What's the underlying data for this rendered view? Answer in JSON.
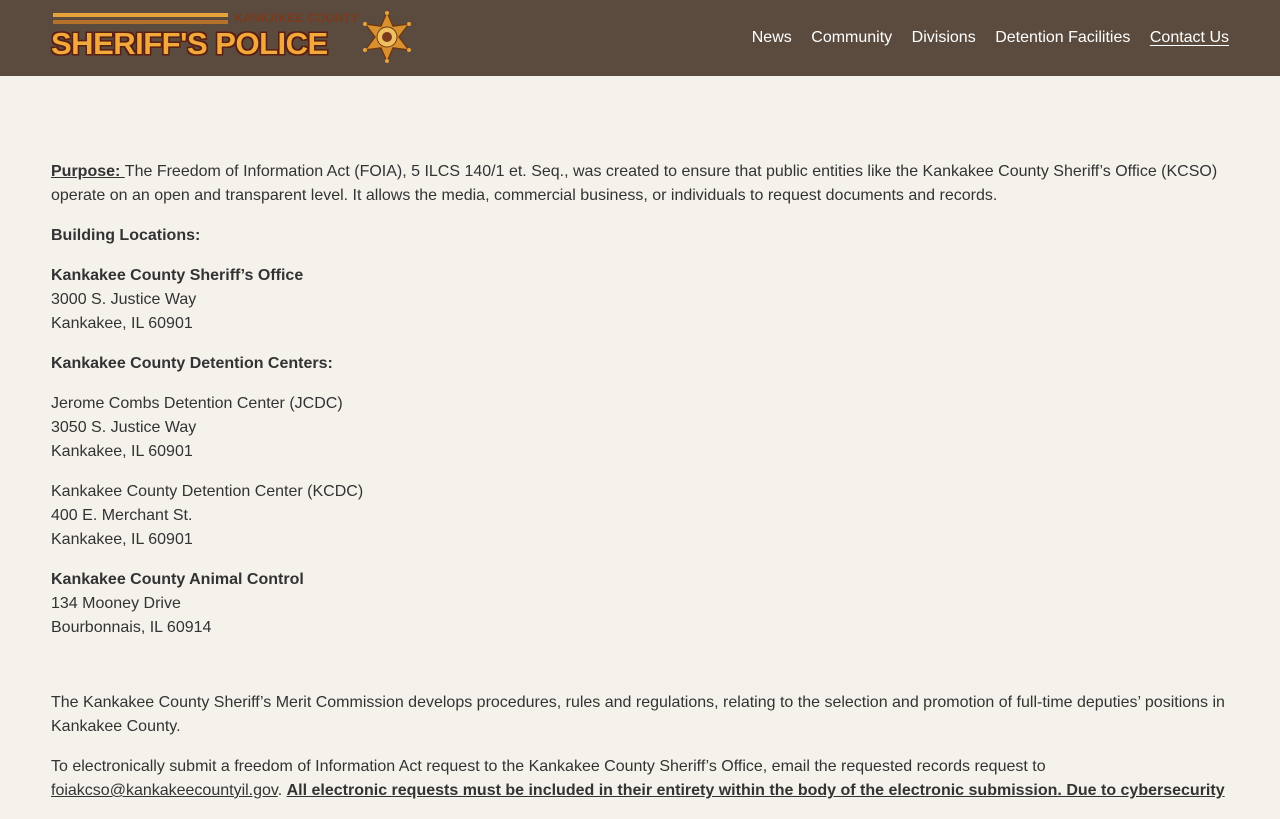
{
  "brand": {
    "county_text": "KANKAKEE COUNTY",
    "main_text": "SHERIFF'S POLICE",
    "star_icon": "sheriff-star-icon",
    "colors": {
      "header_bg": "#5a4b3e",
      "logo_orange": "#f2a93b",
      "logo_red": "#7a3a1e",
      "page_bg": "#f5f2ec"
    }
  },
  "nav": {
    "items": [
      {
        "label": "News"
      },
      {
        "label": "Community"
      },
      {
        "label": "Divisions"
      },
      {
        "label": "Detention Facilities"
      },
      {
        "label": "Contact Us"
      }
    ]
  },
  "content": {
    "purpose_label": "Purpose: ",
    "purpose_text": "The Freedom of Information Act (FOIA), 5 ILCS 140/1 et. Seq., was created to ensure that public entities like the Kankakee County Sheriff’s Office (KCSO) operate on an open and transparent level.  It allows the media, commercial business, or individuals to request documents and records.",
    "building_locations_heading": "Building Locations:",
    "sheriff_office": {
      "name": "Kankakee County Sheriff’s Office",
      "line1": "3000 S. Justice Way",
      "line2": "Kankakee, IL 60901"
    },
    "detention_heading": "Kankakee County Detention Centers:",
    "jcdc": {
      "name": "Jerome Combs Detention Center (JCDC)",
      "line1": "3050 S. Justice Way",
      "line2": "Kankakee, IL 60901"
    },
    "kcdc": {
      "name": "Kankakee County Detention Center (KCDC)",
      "line1": "400 E. Merchant St.",
      "line2": "Kankakee, IL 60901"
    },
    "animal_control": {
      "name": "Kankakee County Animal Control",
      "line1": "134 Mooney Drive",
      "line2": "Bourbonnais, IL 60914"
    },
    "merit_text": "The Kankakee County Sheriff’s Merit Commission develops procedures, rules and regulations, relating to the selection and promotion of full-time deputies’ positions in Kankakee County.",
    "submit_text": " To electronically submit a freedom of Information Act request to the Kankakee County Sheriff’s Office, email the requested records request to ",
    "email": "foiakcso@kankakeecountyil.gov",
    "after_email": ".  ",
    "notice_text": "All electronic requests must be included in their entirety within the body of the electronic submission. Due to cybersecurity"
  }
}
